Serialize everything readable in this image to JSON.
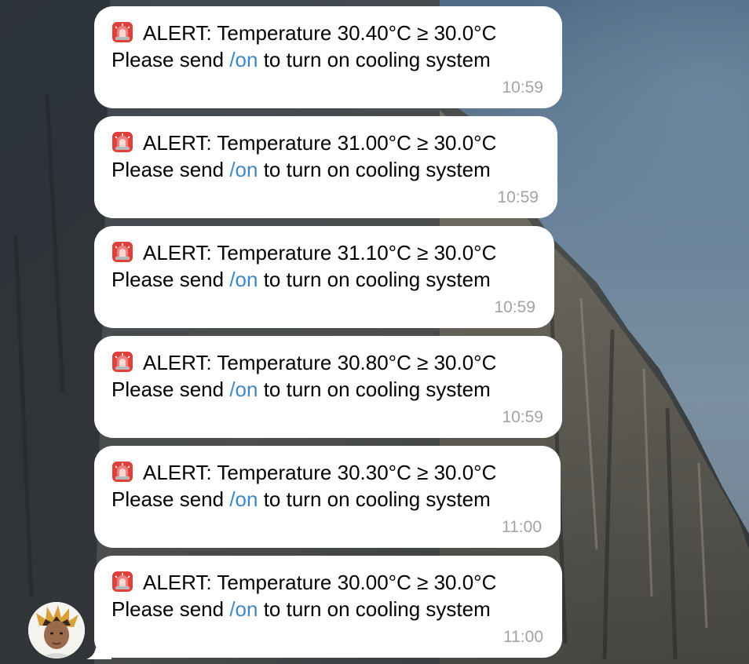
{
  "chat": {
    "messages": [
      {
        "icon": "police-car-light-icon",
        "alert_text": "ALERT: Temperature 30.40°C ≥ 30.0°C",
        "send_prefix": "Please send ",
        "command": "/on",
        "send_suffix": " to turn on cooling system",
        "time": "10:59"
      },
      {
        "icon": "police-car-light-icon",
        "alert_text": "ALERT: Temperature 31.00°C ≥ 30.0°C",
        "send_prefix": "Please send ",
        "command": "/on",
        "send_suffix": " to turn on cooling system",
        "time": "10:59"
      },
      {
        "icon": "police-car-light-icon",
        "alert_text": "ALERT: Temperature 31.10°C ≥ 30.0°C",
        "send_prefix": "Please send ",
        "command": "/on",
        "send_suffix": " to turn on cooling system",
        "time": "10:59"
      },
      {
        "icon": "police-car-light-icon",
        "alert_text": "ALERT: Temperature 30.80°C ≥ 30.0°C",
        "send_prefix": "Please send ",
        "command": "/on",
        "send_suffix": " to turn on cooling system",
        "time": "10:59"
      },
      {
        "icon": "police-car-light-icon",
        "alert_text": "ALERT: Temperature 30.30°C ≥ 30.0°C",
        "send_prefix": "Please send ",
        "command": "/on",
        "send_suffix": " to turn on cooling system",
        "time": "11:00"
      },
      {
        "icon": "police-car-light-icon",
        "alert_text": "ALERT: Temperature 30.00°C ≥ 30.0°C",
        "send_prefix": "Please send ",
        "command": "/on",
        "send_suffix": " to turn on cooling system",
        "time": "11:00"
      }
    ],
    "colors": {
      "bubble": "#ffffff",
      "command_link": "#3d86c9",
      "timestamp": "#a3a3a3",
      "alert_icon": "#e0403a"
    }
  }
}
